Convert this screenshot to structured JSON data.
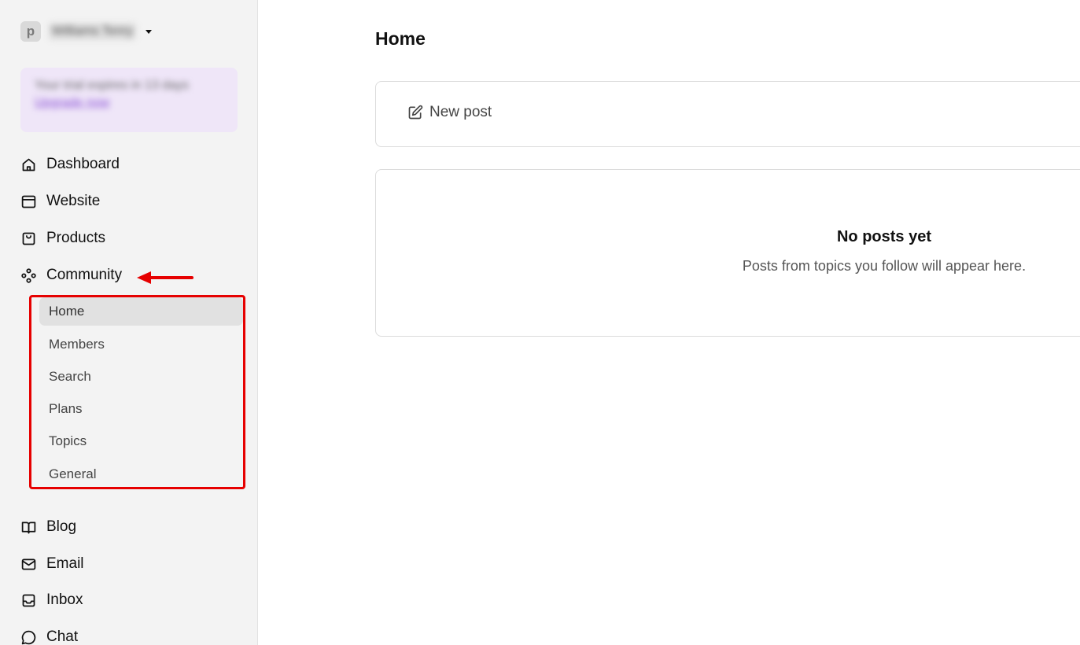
{
  "workspace": {
    "logo_letter": "p",
    "name": "Williams Tenry"
  },
  "trial": {
    "text": "Your trial expires in 13 days",
    "link": "Upgrade now"
  },
  "sidebar": {
    "items": [
      {
        "label": "Dashboard",
        "icon": "home-icon"
      },
      {
        "label": "Website",
        "icon": "browser-window-icon"
      },
      {
        "label": "Products",
        "icon": "shopping-bag-icon"
      },
      {
        "label": "Community",
        "icon": "community-nodes-icon"
      },
      {
        "label": "Blog",
        "icon": "open-book-icon"
      },
      {
        "label": "Email",
        "icon": "envelope-icon"
      },
      {
        "label": "Inbox",
        "icon": "inbox-tray-icon"
      },
      {
        "label": "Chat",
        "icon": "chat-bubble-icon"
      }
    ],
    "community_subnav": [
      {
        "label": "Home",
        "active": true
      },
      {
        "label": "Members",
        "active": false
      },
      {
        "label": "Search",
        "active": false
      },
      {
        "label": "Plans",
        "active": false
      },
      {
        "label": "Topics",
        "active": false
      },
      {
        "label": "General",
        "active": false
      }
    ]
  },
  "main": {
    "title": "Home",
    "new_post_label": "New post",
    "empty_title": "No posts yet",
    "empty_subtitle": "Posts from topics you follow will appear here."
  },
  "colors": {
    "annotation_red": "#e60000",
    "trial_bg": "#efe6f8",
    "active_item_bg": "#e1e1e1"
  }
}
